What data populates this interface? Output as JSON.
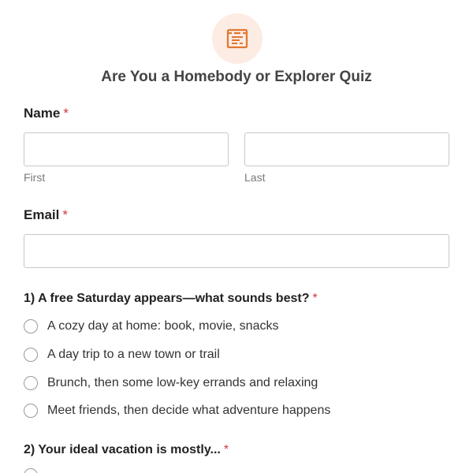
{
  "form": {
    "icon": "form-list-icon",
    "title": "Are You a Homebody or Explorer Quiz",
    "accent_color": "#e27730",
    "required_color": "#d63637"
  },
  "name_field": {
    "label": "Name",
    "required_mark": "*",
    "first": {
      "value": "",
      "sublabel": "First"
    },
    "last": {
      "value": "",
      "sublabel": "Last"
    }
  },
  "email_field": {
    "label": "Email",
    "required_mark": "*",
    "value": ""
  },
  "question1": {
    "label": "1) A free Saturday appears—what sounds best?",
    "required_mark": "*",
    "options": [
      "A cozy day at home: book, movie, snacks",
      "A day trip to a new town or trail",
      "Brunch, then some low-key errands and relaxing",
      "Meet friends, then decide what adventure happens"
    ]
  },
  "question2": {
    "label": "2) Your ideal vacation is mostly...",
    "required_mark": "*"
  }
}
